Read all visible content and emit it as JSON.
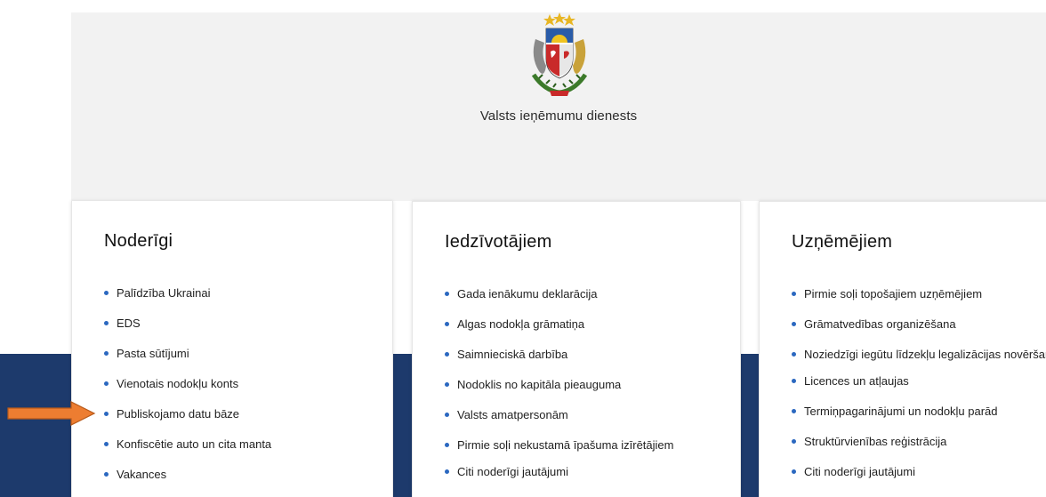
{
  "header": {
    "agency_name": "Valsts ieņēmumu dienests",
    "emblem": "latvia-coat-of-arms"
  },
  "cards": [
    {
      "title": "Noderīgi",
      "items": [
        "Palīdzība Ukrainai",
        "EDS",
        "Pasta sūtījumi",
        "Vienotais nodokļu konts",
        "Publiskojamo datu bāze",
        "Konfiscētie auto un cita manta",
        "Vakances"
      ]
    },
    {
      "title": "Iedzīvotājiem",
      "items": [
        "Gada ienākumu deklarācija",
        "Algas nodokļa grāmatiņa",
        "Saimnieciskā darbība",
        "Nodoklis no kapitāla pieauguma",
        "Valsts amatpersonām",
        "Pirmie soļi nekustamā īpašuma izīrētājiem",
        "Citi noderīgi jautājumi"
      ]
    },
    {
      "title": "Uzņēmējiem",
      "items": [
        "Pirmie soļi topošajiem uzņēmējiem",
        "Grāmatvedības organizēšana",
        "Noziedzīgi iegūtu līdzekļu legalizācijas novēršana",
        "Licences un atļaujas",
        "Termiņpagarinājumi un nodokļu parād",
        "Struktūrvienības reģistrācija",
        "Citi noderīgi jautājumi"
      ]
    }
  ],
  "annotation": {
    "arrow_color": "#ed7d31",
    "points_to": "Publiskojamo datu bāze"
  },
  "colors": {
    "bullet": "#2b68c0",
    "hero_bg": "#f2f2f2",
    "band": "#1d3a6c"
  }
}
